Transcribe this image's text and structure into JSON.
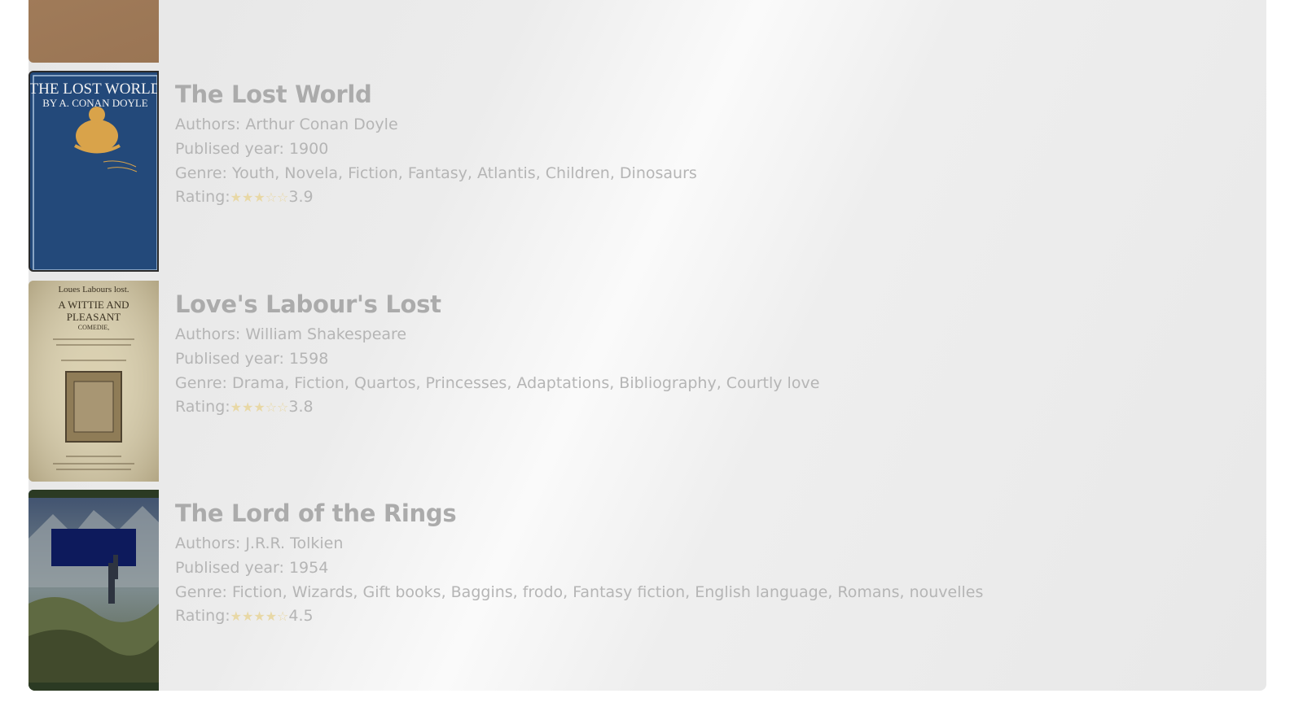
{
  "labels": {
    "authors": "Authors: ",
    "year": "Publised year: ",
    "genre": "Genre: ",
    "rating": "Rating:"
  },
  "books": [
    {
      "title": "The Lost World",
      "authors": "Arthur Conan Doyle",
      "year": "1900",
      "genre": "Youth, Novela, Fiction, Fantasy, Atlantis, Children, Dinosaurs",
      "stars": "★★★☆☆",
      "rating": "3.9",
      "cover_text": [
        "THE LOST WORLD",
        "BY A. CONAN DOYLE"
      ]
    },
    {
      "title": "Love's Labour's Lost",
      "authors": "William Shakespeare",
      "year": "1598",
      "genre": "Drama, Fiction, Quartos, Princesses, Adaptations, Bibliography, Courtly love",
      "stars": "★★★☆☆",
      "rating": "3.8",
      "cover_text": [
        "Loues Labours lost.",
        "A WITTIE AND",
        "PLEASANT",
        "COMEDIE,"
      ]
    },
    {
      "title": "The Lord of the Rings",
      "authors": "J.R.R. Tolkien",
      "year": "1954",
      "genre": "Fiction, Wizards, Gift books, Baggins, frodo, Fantasy fiction, English language, Romans, nouvelles",
      "stars": "★★★★☆",
      "rating": "4.5"
    }
  ],
  "colors": {
    "text": "#b5b5b5",
    "title": "#ababab",
    "stars": "#e8d8a6"
  }
}
